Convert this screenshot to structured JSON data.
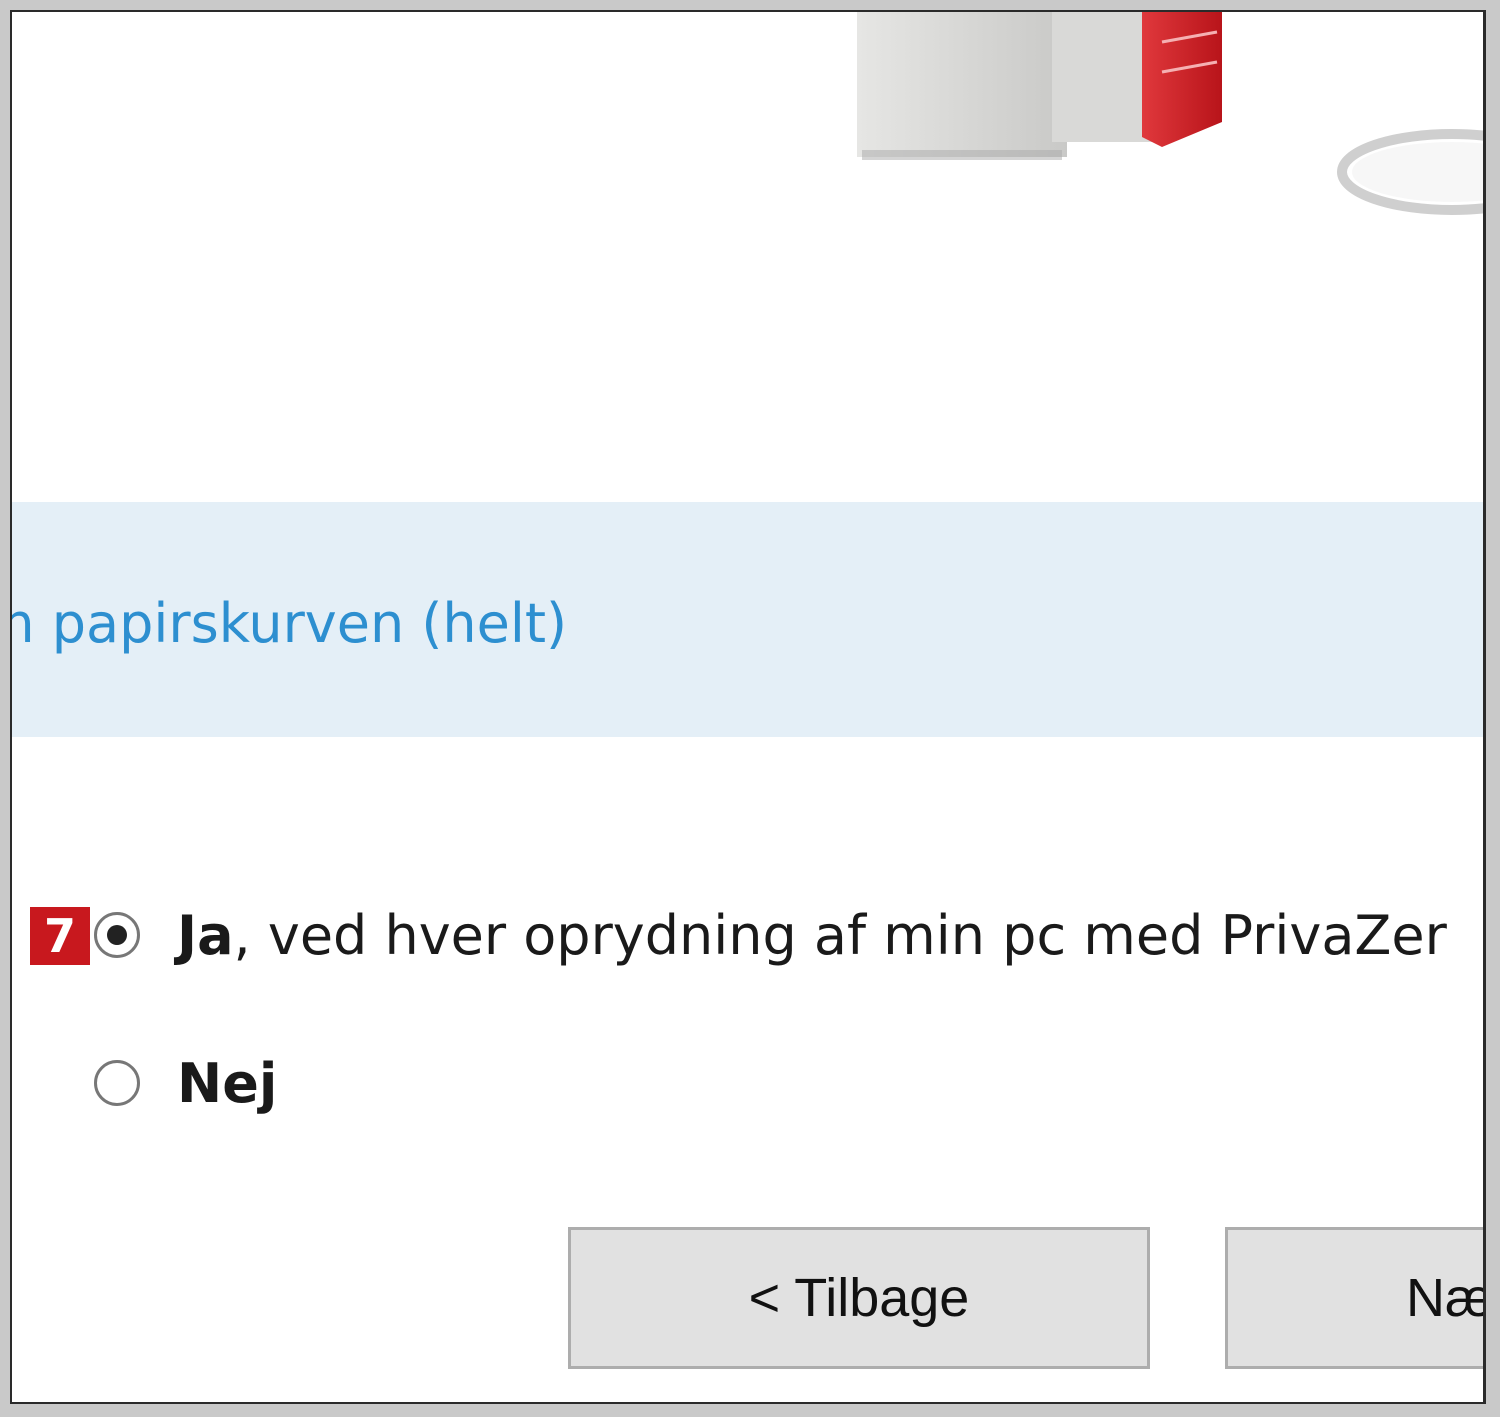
{
  "section": {
    "title": "m papirskurven (helt)"
  },
  "options": {
    "step_badge": "7",
    "yes": {
      "label_bold": "Ja",
      "label_rest": ", ved hver oprydning af min pc med PrivaZer",
      "selected": true
    },
    "no": {
      "label": "Nej",
      "selected": false
    }
  },
  "buttons": {
    "back_label": "< Tilbage",
    "next_label": "Næ"
  },
  "colors": {
    "accent_text": "#2d8fd0",
    "banner_background": "#e4eff7",
    "badge_red": "#c8181e",
    "button_background": "#e1e1e1"
  }
}
